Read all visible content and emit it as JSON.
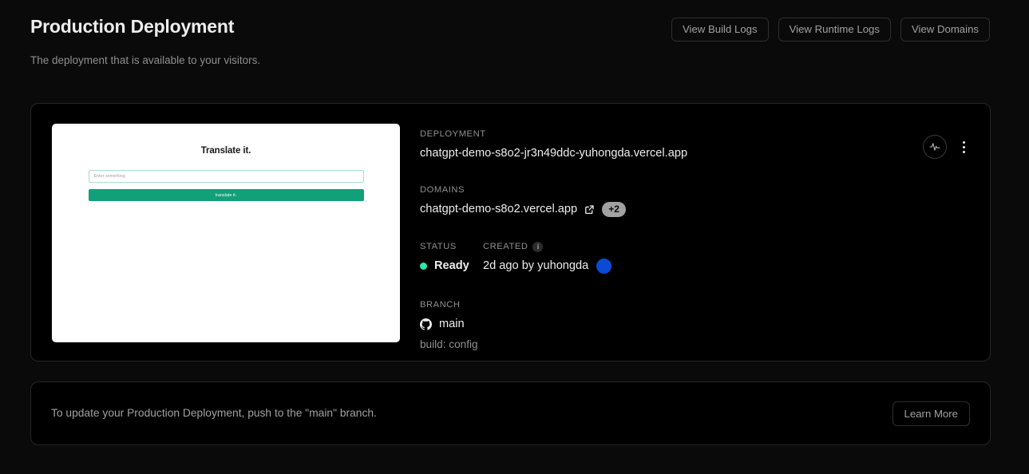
{
  "header": {
    "title": "Production Deployment",
    "subtitle": "The deployment that is available to your visitors.",
    "actions": [
      {
        "label": "View Build Logs"
      },
      {
        "label": "View Runtime Logs"
      },
      {
        "label": "View Domains"
      }
    ]
  },
  "preview": {
    "title": "Translate it.",
    "input_placeholder": "Enter something",
    "button_label": "translate it.",
    "accent_color": "#12a07a",
    "input_border_color": "#a8ddcb"
  },
  "deployment": {
    "deployment_label": "DEPLOYMENT",
    "deployment_url": "chatgpt-demo-s8o2-jr3n49ddc-yuhongda.vercel.app",
    "domains_label": "DOMAINS",
    "domain_primary": "chatgpt-demo-s8o2.vercel.app",
    "domain_extra_count": "+2",
    "external_link_icon": "external-link-icon",
    "status_label": "STATUS",
    "status_value": "Ready",
    "status_color": "#2ee6b0",
    "created_label": "CREATED",
    "created_info_icon": "i",
    "created_value": "2d ago by yuhongda",
    "avatar_color": "#0b4ad4",
    "branch_label": "BRANCH",
    "branch_icon": "github-icon",
    "branch_name": "main",
    "branch_sub": "build: config",
    "activity_icon": "activity-pulse-icon",
    "menu_icon": "kebab-menu-icon"
  },
  "banner": {
    "text": "To update your Production Deployment, push to the \"main\" branch.",
    "button_label": "Learn More"
  }
}
